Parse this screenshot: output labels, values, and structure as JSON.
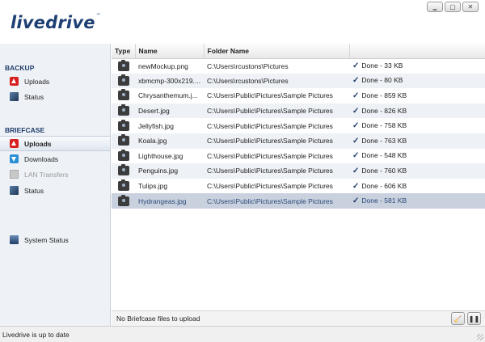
{
  "app": {
    "logo": "livedrive",
    "trademark": "™"
  },
  "window_controls": [
    "‗",
    "▢",
    "✕"
  ],
  "sidebar": {
    "backup_header": "BACKUP",
    "backup_items": [
      {
        "label": "Uploads",
        "icon": "upload-icon"
      },
      {
        "label": "Status",
        "icon": "status-icon"
      }
    ],
    "briefcase_header": "BRIEFCASE",
    "briefcase_items": [
      {
        "label": "Uploads",
        "icon": "upload-icon",
        "active": true
      },
      {
        "label": "Downloads",
        "icon": "download-icon"
      },
      {
        "label": "LAN Transfers",
        "icon": "lan-icon",
        "disabled": true
      },
      {
        "label": "Status",
        "icon": "status-icon"
      }
    ],
    "system_status": "System Status"
  },
  "table": {
    "columns": [
      "Type",
      "Name",
      "Folder Name",
      ""
    ],
    "rows": [
      {
        "name": "newMockup.png",
        "folder": "C:\\Users\\rcustons\\Pictures",
        "status": "Done - 33 KB"
      },
      {
        "name": "xbmcmp-300x219....",
        "folder": "C:\\Users\\rcustons\\Pictures",
        "status": "Done - 80 KB"
      },
      {
        "name": "Chrysanthemum.j...",
        "folder": "C:\\Users\\Public\\Pictures\\Sample Pictures",
        "status": "Done - 859 KB"
      },
      {
        "name": "Desert.jpg",
        "folder": "C:\\Users\\Public\\Pictures\\Sample Pictures",
        "status": "Done - 826 KB"
      },
      {
        "name": "Jellyfish.jpg",
        "folder": "C:\\Users\\Public\\Pictures\\Sample Pictures",
        "status": "Done - 758 KB"
      },
      {
        "name": "Koala.jpg",
        "folder": "C:\\Users\\Public\\Pictures\\Sample Pictures",
        "status": "Done - 763 KB"
      },
      {
        "name": "Lighthouse.jpg",
        "folder": "C:\\Users\\Public\\Pictures\\Sample Pictures",
        "status": "Done - 548 KB"
      },
      {
        "name": "Penguins.jpg",
        "folder": "C:\\Users\\Public\\Pictures\\Sample Pictures",
        "status": "Done - 760 KB"
      },
      {
        "name": "Tulips.jpg",
        "folder": "C:\\Users\\Public\\Pictures\\Sample Pictures",
        "status": "Done - 606 KB"
      },
      {
        "name": "Hydrangeas.jpg",
        "folder": "C:\\Users\\Public\\Pictures\\Sample Pictures",
        "status": "Done - 581 KB",
        "selected": true
      }
    ]
  },
  "bottom_bar": {
    "message": "No Briefcase files to upload",
    "clear_icon": "broom-icon",
    "pause_label": "❚❚"
  },
  "status_bar": {
    "text": "Livedrive is up to date"
  },
  "colors": {
    "brand": "#1d3f72",
    "selection": "#c9d1de",
    "alt_row": "#eef1f6"
  }
}
